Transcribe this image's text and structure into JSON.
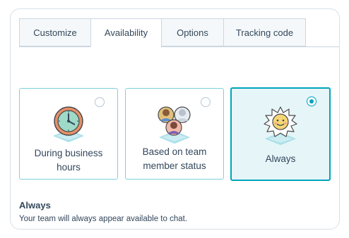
{
  "tabs": [
    {
      "label": "Customize",
      "active": false
    },
    {
      "label": "Availability",
      "active": true
    },
    {
      "label": "Options",
      "active": false
    },
    {
      "label": "Tracking code",
      "active": false
    }
  ],
  "options": [
    {
      "label_line1": "During business",
      "label_line2": "hours",
      "selected": false,
      "icon": "clock-icon"
    },
    {
      "label_line1": "Based on team",
      "label_line2": "member status",
      "selected": false,
      "icon": "team-avatars-icon"
    },
    {
      "label_line1": "Always",
      "label_line2": "",
      "selected": true,
      "icon": "sun-icon"
    }
  ],
  "selected_option": {
    "title": "Always",
    "description": "Your team will always appear available to chat."
  },
  "colors": {
    "accent": "#00a4bd",
    "selected_bg": "#e5f5f8",
    "text": "#33475b",
    "border": "#cbd6e2"
  }
}
